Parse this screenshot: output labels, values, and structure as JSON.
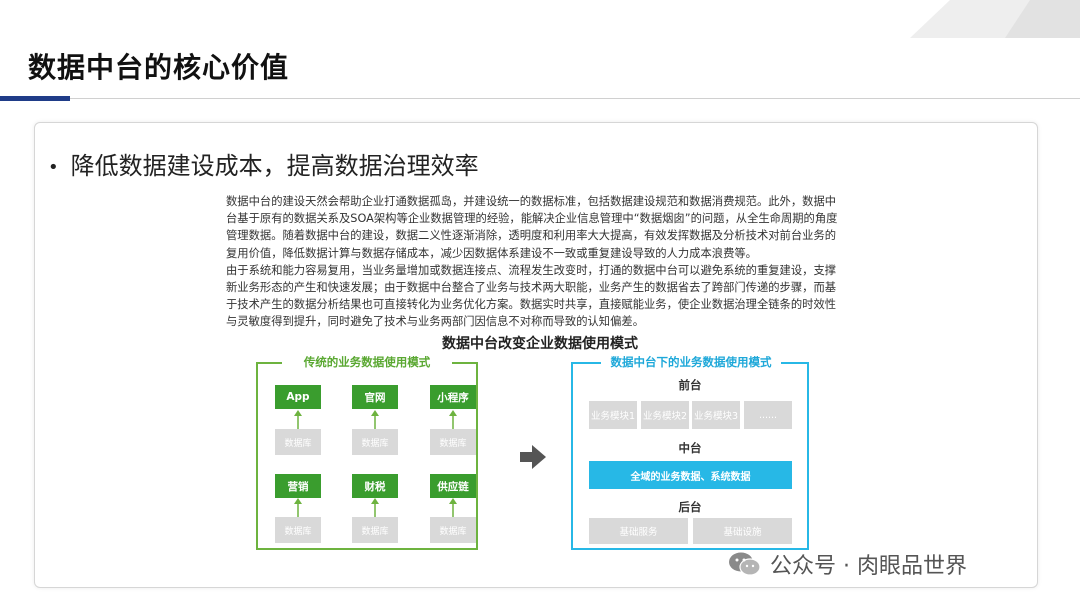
{
  "slide": {
    "title": "数据中台的核心价值",
    "bullet": "降低数据建设成本，提高数据治理效率",
    "paragraphs": [
      "数据中台的建设天然会帮助企业打通数据孤岛，并建设统一的数据标准，包括数据建设规范和数据消费规范。此外，数据中台基于原有的数据关系及SOA架构等企业数据管理的经验，能解决企业信息管理中“数据烟囱”的问题，从全生命周期的角度管理数据。随着数据中台的建设，数据二义性逐渐消除，透明度和利用率大大提高，有效发挥数据及分析技术对前台业务的复用价值，降低数据计算与数据存储成本，减少因数据体系建设不一致或重复建设导致的人力成本浪费等。",
      "由于系统和能力容易复用，当业务量增加或数据连接点、流程发生改变时，打通的数据中台可以避免系统的重复建设，支撑新业务形态的产生和快速发展；由于数据中台整合了业务与技术两大职能，业务产生的数据省去了跨部门传递的步骤，而基于技术产生的数据分析结果也可直接转化为业务优化方案。数据实时共享，直接赋能业务，使企业数据治理全链条的时效性与灵敏度得到提升，同时避免了技术与业务两部门因信息不对称而导致的认知偏差。"
    ]
  },
  "diagram": {
    "title": "数据中台改变企业数据使用模式",
    "left": {
      "title": "传统的业务数据使用模式",
      "top_apps": [
        "App",
        "官网",
        "小程序"
      ],
      "bottom_apps": [
        "营销",
        "财税",
        "供应链"
      ],
      "db_label": "数据库"
    },
    "right": {
      "title": "数据中台下的业务数据使用模式",
      "front_label": "前台",
      "modules": [
        "业务模块1",
        "业务模块2",
        "业务模块3",
        "......"
      ],
      "middle_label": "中台",
      "middle_bar": "全域的业务数据、系统数据",
      "back_label": "后台",
      "services": [
        "基础服务",
        "基础设施"
      ]
    }
  },
  "watermark": {
    "text": "公众号 · 肉眼品世界"
  },
  "colors": {
    "accent_blue": "#1f3c88",
    "green": "#3a9d2e",
    "cyan": "#27b8e6",
    "gray_box": "#d9d9d9"
  }
}
